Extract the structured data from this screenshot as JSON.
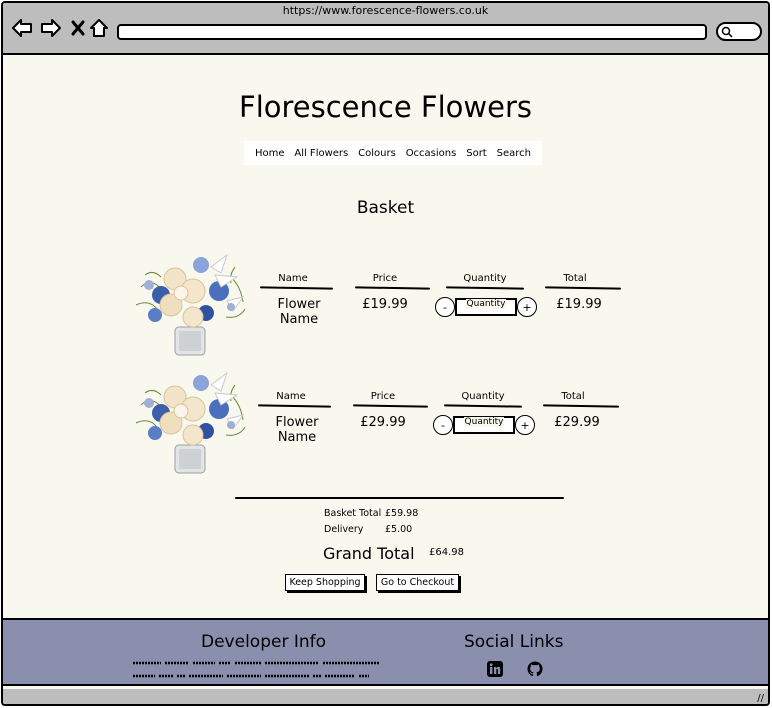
{
  "browser": {
    "url": "https://www.forescence-flowers.co.uk"
  },
  "site": {
    "title": "Florescence Flowers"
  },
  "nav": {
    "items": [
      "Home",
      "All Flowers",
      "Colours",
      "Occasions",
      "Sort",
      "Search"
    ]
  },
  "basket": {
    "heading": "Basket",
    "headers": {
      "name": "Name",
      "price": "Price",
      "quantity": "Quantity",
      "total": "Total"
    },
    "items": [
      {
        "name": "Flower Name",
        "price": "£19.99",
        "quantity_label": "Quantity",
        "minus": "-",
        "plus": "+",
        "total": "£19.99"
      },
      {
        "name": "Flower Name",
        "price": "£29.99",
        "quantity_label": "Quantity",
        "minus": "-",
        "plus": "+",
        "total": "£29.99"
      }
    ]
  },
  "summary": {
    "basket_total_label": "Basket Total",
    "basket_total_value": "£59.98",
    "delivery_label": "Delivery",
    "delivery_value": "£5.00",
    "grand_total_label": "Grand Total",
    "grand_total_value": "£64.98"
  },
  "actions": {
    "keep_shopping": "Keep Shopping",
    "checkout": "Go to Checkout"
  },
  "footer": {
    "developer_title": "Developer Info",
    "social_title": "Social Links",
    "social_icons": [
      "linkedin-icon",
      "github-icon"
    ]
  },
  "colors": {
    "page_bg": "#f9f8ee",
    "chrome_bg": "#bdbdbd",
    "footer_bg": "#8a8fae"
  }
}
